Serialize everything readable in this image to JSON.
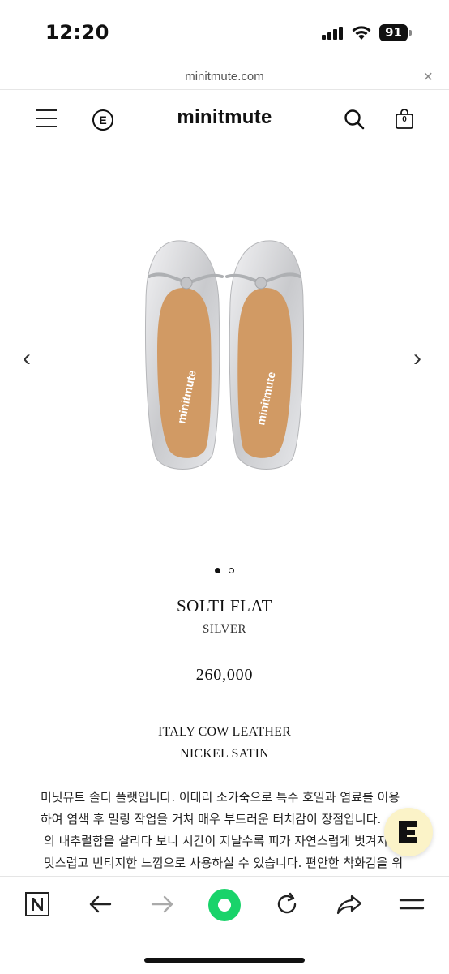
{
  "status_bar": {
    "time": "12:20",
    "battery": "91"
  },
  "browser": {
    "url": "minitmute.com",
    "close_label": "×"
  },
  "header": {
    "logo": "minitmute",
    "cart_count": "0",
    "e_badge": "E"
  },
  "gallery": {
    "prev_label": "‹",
    "next_label": "›",
    "slide_count": 2,
    "active_slide": 1,
    "shoe_brand": "minitmute"
  },
  "product": {
    "name": "SOLTI FLAT",
    "color": "SILVER",
    "price": "260,000",
    "materials": [
      "ITALY COW LEATHER",
      "NICKEL SATIN"
    ],
    "description_lines": [
      "미닛뮤트 솔티 플랫입니다. 이태리 소가죽으로 특수 호일과 염료를 이용",
      "하여 염색 후 밀링 작업을 거쳐 매우 부드러운 터치감이 장점입니다.",
      "의 내추럴함을 살리다 보니 시간이 지날수록 피가 자연스럽게 벗겨지",
      "멋스럽고 빈티지한 느낌으로 사용하실 수 있습니다. 편안한 착화감을 위"
    ]
  },
  "toolbar": {
    "icons": [
      "naver-n-icon",
      "back-arrow-icon",
      "forward-arrow-icon",
      "green-home-icon",
      "reload-icon",
      "share-icon",
      "menu-icon"
    ],
    "accent": "#19d36a"
  }
}
